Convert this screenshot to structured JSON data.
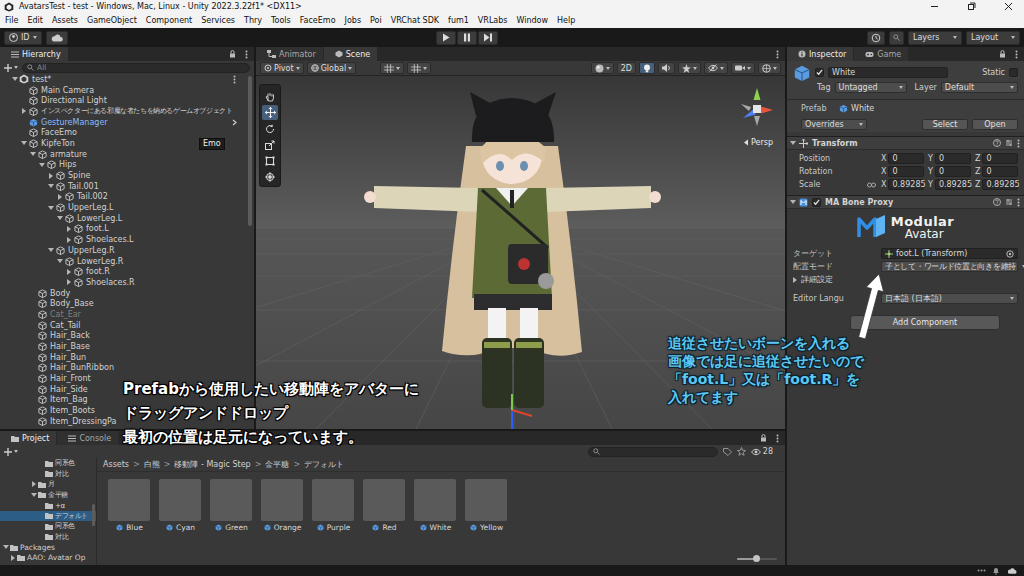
{
  "window": {
    "title": "AvatarsTest - test - Windows, Mac, Linux - Unity 2022.3.22f1* <DX11>"
  },
  "menu": [
    "File",
    "Edit",
    "Assets",
    "GameObject",
    "Component",
    "Services",
    "Thry",
    "Tools",
    "FaceEmo",
    "Jobs",
    "Poi",
    "VRChat SDK",
    "fum1",
    "VRLabs",
    "Window",
    "Help"
  ],
  "toolbar": {
    "account": "ID",
    "layers": "Layers",
    "layout": "Layout"
  },
  "hierarchy": {
    "title": "Hierarchy",
    "search": "All",
    "tooltip": "Emo",
    "items": [
      {
        "label": "test*",
        "depth": 0,
        "kind": "scene",
        "expandable": true,
        "expanded": true,
        "prefab": false,
        "disabled": false,
        "selected": false
      },
      {
        "label": "Main Camera",
        "depth": 1,
        "kind": "object",
        "expandable": false,
        "expanded": false,
        "prefab": false,
        "disabled": false,
        "selected": false
      },
      {
        "label": "Directional Light",
        "depth": 1,
        "kind": "object",
        "expandable": false,
        "expanded": false,
        "prefab": false,
        "disabled": false,
        "selected": false
      },
      {
        "label": "インスペクターにある邪魔な者たちを納めるゲームオブジェクト",
        "depth": 1,
        "kind": "object",
        "expandable": true,
        "expanded": false,
        "prefab": false,
        "disabled": false,
        "selected": false
      },
      {
        "label": "GestureManager",
        "depth": 1,
        "kind": "object",
        "expandable": false,
        "expanded": false,
        "prefab": true,
        "disabled": false,
        "selected": false
      },
      {
        "label": "FaceEmo",
        "depth": 1,
        "kind": "object",
        "expandable": false,
        "expanded": false,
        "prefab": false,
        "disabled": false,
        "selected": false
      },
      {
        "label": "KipfeTon",
        "depth": 1,
        "kind": "object",
        "expandable": true,
        "expanded": true,
        "prefab": false,
        "disabled": false,
        "selected": false
      },
      {
        "label": "armature",
        "depth": 2,
        "kind": "object",
        "expandable": true,
        "expanded": true,
        "prefab": false,
        "disabled": false,
        "selected": false
      },
      {
        "label": "Hips",
        "depth": 3,
        "kind": "object",
        "expandable": true,
        "expanded": true,
        "prefab": false,
        "disabled": false,
        "selected": false
      },
      {
        "label": "Spine",
        "depth": 4,
        "kind": "object",
        "expandable": true,
        "expanded": false,
        "prefab": false,
        "disabled": false,
        "selected": false
      },
      {
        "label": "Tail.001",
        "depth": 4,
        "kind": "object",
        "expandable": true,
        "expanded": true,
        "prefab": false,
        "disabled": false,
        "selected": false
      },
      {
        "label": "Tail.002",
        "depth": 5,
        "kind": "object",
        "expandable": true,
        "expanded": false,
        "prefab": false,
        "disabled": false,
        "selected": false
      },
      {
        "label": "UpperLeg.L",
        "depth": 4,
        "kind": "object",
        "expandable": true,
        "expanded": true,
        "prefab": false,
        "disabled": false,
        "selected": false
      },
      {
        "label": "LowerLeg.L",
        "depth": 5,
        "kind": "object",
        "expandable": true,
        "expanded": true,
        "prefab": false,
        "disabled": false,
        "selected": false
      },
      {
        "label": "foot.L",
        "depth": 6,
        "kind": "object",
        "expandable": true,
        "expanded": false,
        "prefab": false,
        "disabled": false,
        "selected": false
      },
      {
        "label": "Shoelaces.L",
        "depth": 6,
        "kind": "object",
        "expandable": true,
        "expanded": false,
        "prefab": false,
        "disabled": false,
        "selected": false
      },
      {
        "label": "UpperLeg.R",
        "depth": 4,
        "kind": "object",
        "expandable": true,
        "expanded": true,
        "prefab": false,
        "disabled": false,
        "selected": false
      },
      {
        "label": "LowerLeg.R",
        "depth": 5,
        "kind": "object",
        "expandable": true,
        "expanded": true,
        "prefab": false,
        "disabled": false,
        "selected": false
      },
      {
        "label": "foot.R",
        "depth": 6,
        "kind": "object",
        "expandable": true,
        "expanded": false,
        "prefab": false,
        "disabled": false,
        "selected": false
      },
      {
        "label": "Shoelaces.R",
        "depth": 6,
        "kind": "object",
        "expandable": true,
        "expanded": false,
        "prefab": false,
        "disabled": false,
        "selected": false
      },
      {
        "label": "Body",
        "depth": 2,
        "kind": "object",
        "expandable": false,
        "expanded": false,
        "prefab": false,
        "disabled": false,
        "selected": false
      },
      {
        "label": "Body_Base",
        "depth": 2,
        "kind": "object",
        "expandable": false,
        "expanded": false,
        "prefab": false,
        "disabled": false,
        "selected": false
      },
      {
        "label": "Cat_Ear",
        "depth": 2,
        "kind": "object",
        "expandable": false,
        "expanded": false,
        "prefab": false,
        "disabled": true,
        "selected": false
      },
      {
        "label": "Cat_Tail",
        "depth": 2,
        "kind": "object",
        "expandable": false,
        "expanded": false,
        "prefab": false,
        "disabled": false,
        "selected": false
      },
      {
        "label": "Hair_Back",
        "depth": 2,
        "kind": "object",
        "expandable": false,
        "expanded": false,
        "prefab": false,
        "disabled": false,
        "selected": false
      },
      {
        "label": "Hair_Base",
        "depth": 2,
        "kind": "object",
        "expandable": false,
        "expanded": false,
        "prefab": false,
        "disabled": false,
        "selected": false
      },
      {
        "label": "Hair_Bun",
        "depth": 2,
        "kind": "object",
        "expandable": false,
        "expanded": false,
        "prefab": false,
        "disabled": false,
        "selected": false
      },
      {
        "label": "Hair_BunRibbon",
        "depth": 2,
        "kind": "object",
        "expandable": false,
        "expanded": false,
        "prefab": false,
        "disabled": false,
        "selected": false
      },
      {
        "label": "Hair_Front",
        "depth": 2,
        "kind": "object",
        "expandable": false,
        "expanded": false,
        "prefab": false,
        "disabled": false,
        "selected": false
      },
      {
        "label": "Hair_Side",
        "depth": 2,
        "kind": "object",
        "expandable": false,
        "expanded": false,
        "prefab": false,
        "disabled": false,
        "selected": false
      },
      {
        "label": "Item_Bag",
        "depth": 2,
        "kind": "object",
        "expandable": false,
        "expanded": false,
        "prefab": false,
        "disabled": false,
        "selected": false
      },
      {
        "label": "Item_Boots",
        "depth": 2,
        "kind": "object",
        "expandable": false,
        "expanded": false,
        "prefab": false,
        "disabled": false,
        "selected": false
      },
      {
        "label": "Item_DressingPa",
        "depth": 2,
        "kind": "object",
        "expandable": false,
        "expanded": false,
        "prefab": false,
        "disabled": false,
        "selected": false
      }
    ]
  },
  "scene": {
    "tabs": [
      {
        "label": "Animator",
        "selected": false
      },
      {
        "label": "Scene",
        "selected": true
      }
    ],
    "pivot": "Pivot",
    "global": "Global",
    "mode_2d": "2D",
    "lighting_on": true,
    "projection": "Persp",
    "tools": [
      {
        "selected": false
      },
      {
        "selected": true
      },
      {
        "selected": false
      },
      {
        "selected": false
      },
      {
        "selected": false
      },
      {
        "selected": false
      }
    ]
  },
  "inspector": {
    "tabs": [
      {
        "label": "Inspector",
        "selected": true
      },
      {
        "label": "Game",
        "selected": false
      }
    ],
    "object": {
      "active": true,
      "name": "White",
      "static_label": "Static",
      "static": false,
      "tag_label": "Tag",
      "tag": "Untagged",
      "layer_label": "Layer",
      "layer": "Default"
    },
    "prefab": {
      "label": "Prefab",
      "asset": "White",
      "overrides": "Overrides",
      "select": "Select",
      "open": "Open"
    },
    "transform": {
      "title": "Transform",
      "expanded": true,
      "rows": [
        {
          "label": "Position",
          "values": [
            {
              "axis": "X",
              "value": "0"
            },
            {
              "axis": "Y",
              "value": "0"
            },
            {
              "axis": "Z",
              "value": "0"
            }
          ]
        },
        {
          "label": "Rotation",
          "values": [
            {
              "axis": "X",
              "value": "0"
            },
            {
              "axis": "Y",
              "value": "0"
            },
            {
              "axis": "Z",
              "value": "0"
            }
          ]
        },
        {
          "label": "Scale",
          "values": [
            {
              "axis": "X",
              "value": "0.89285"
            },
            {
              "axis": "Y",
              "value": "0.89285"
            },
            {
              "axis": "Z",
              "value": "0.89285"
            }
          ]
        }
      ]
    },
    "bone_proxy": {
      "title": "MA Bone Proxy",
      "enabled": true,
      "expanded": true,
      "logo": [
        "Modular",
        "Avatar"
      ],
      "fields": [
        {
          "label": "ターゲット",
          "value": "foot.L (Transform)",
          "kind": "object"
        },
        {
          "label": "配置モード",
          "value": "子として・ワールド位置と向きを維持",
          "kind": "dropdown"
        }
      ],
      "advanced": {
        "label": "詳細設定",
        "expanded": false
      },
      "language": {
        "label": "Editor Langu",
        "value": "日本語 (日本語)"
      }
    },
    "add_component": "Add Component"
  },
  "project": {
    "tabs": [
      {
        "label": "Project",
        "selected": true
      },
      {
        "label": "Console",
        "selected": false
      }
    ],
    "tree": [
      {
        "label": "同系色",
        "depth": 5,
        "expandable": false,
        "expanded": false,
        "selected": false
      },
      {
        "label": "対比",
        "depth": 5,
        "expandable": false,
        "expanded": false,
        "selected": false
      },
      {
        "label": "月",
        "depth": 4,
        "expandable": true,
        "expanded": false,
        "selected": false
      },
      {
        "label": "金平糖",
        "depth": 4,
        "expandable": true,
        "expanded": true,
        "selected": false
      },
      {
        "label": "+α",
        "depth": 5,
        "expandable": false,
        "expanded": false,
        "selected": false
      },
      {
        "label": "デフォルト",
        "depth": 5,
        "expandable": false,
        "expanded": false,
        "selected": true
      },
      {
        "label": "同系色",
        "depth": 5,
        "expandable": false,
        "expanded": false,
        "selected": false
      },
      {
        "label": "対比",
        "depth": 5,
        "expandable": false,
        "expanded": false,
        "selected": false
      },
      {
        "label": "Packages",
        "depth": 0,
        "expandable": true,
        "expanded": true,
        "selected": false
      },
      {
        "label": "AAO: Avatar Op",
        "depth": 1,
        "expandable": true,
        "expanded": false,
        "selected": false
      }
    ],
    "breadcrumb": [
      "Assets",
      "白熊",
      "移動陣 - Magic Step",
      "金平糖",
      "デフォルト"
    ],
    "separator": ">",
    "count": "28",
    "assets": [
      {
        "label": "Blue"
      },
      {
        "label": "Cyan"
      },
      {
        "label": "Green"
      },
      {
        "label": "Orange"
      },
      {
        "label": "Purple"
      },
      {
        "label": "Red"
      },
      {
        "label": "White"
      },
      {
        "label": "Yellow"
      }
    ],
    "zoom": 0.5
  },
  "captions": {
    "scene": "Prefabから使用したい移動陣をアバターに\nドラッグアンドドロップ\n最初の位置は足元になっています。",
    "inspector": "追従させたいボーンを入れる\n画像では足に追従させたいので\n「foot.L」又は「foot.R」を\n入れてます"
  }
}
